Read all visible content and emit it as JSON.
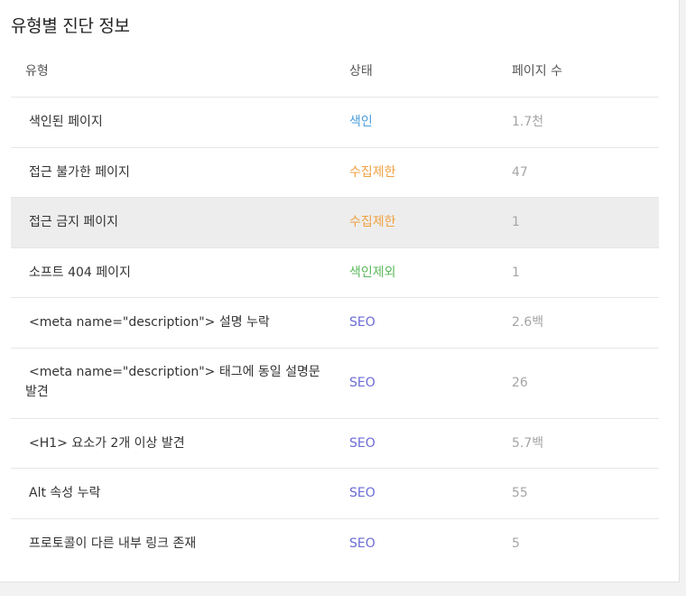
{
  "page_title": "유형별 진단 정보",
  "table": {
    "headers": [
      "유형",
      "상태",
      "페이지 수"
    ],
    "rows": [
      {
        "type": "색인된 페이지",
        "status": "색인",
        "status_color": "#4a9ede",
        "count": "1.7천"
      },
      {
        "type": "접근 불가한 페이지",
        "status": "수집제한",
        "status_color": "#f0a040",
        "count": "47"
      },
      {
        "type": "접근 금지 페이지",
        "status": "수집제한",
        "status_color": "#f0a040",
        "count": "1",
        "highlighted": true
      },
      {
        "type": "소프트 404 페이지",
        "status": "색인제외",
        "status_color": "#5cb85c",
        "count": "1"
      },
      {
        "type": "<meta name=\"description\"> 설명 누락",
        "status": "SEO",
        "status_color": "#6b6bd6",
        "count": "2.6백"
      },
      {
        "type": "<meta name=\"description\"> 태그에 동일 설명문 발견",
        "status": "SEO",
        "status_color": "#6b6bd6",
        "count": "26"
      },
      {
        "type": "<H1> 요소가 2개 이상 발견",
        "status": "SEO",
        "status_color": "#6b6bd6",
        "count": "5.7백"
      },
      {
        "type": "Alt 속성 누락",
        "status": "SEO",
        "status_color": "#6b6bd6",
        "count": "55"
      },
      {
        "type": "프로토콜이 다른 내부 링크 존재",
        "status": "SEO",
        "status_color": "#6b6bd6",
        "count": "5"
      }
    ]
  }
}
